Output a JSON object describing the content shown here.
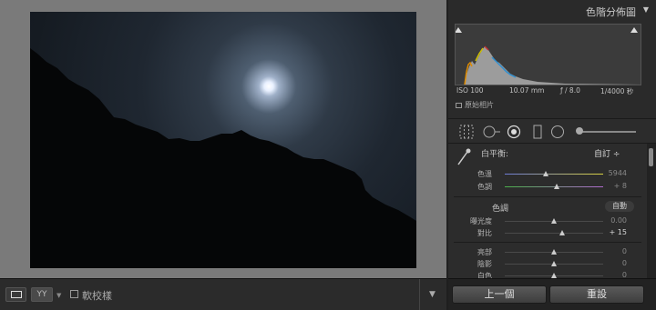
{
  "histogram": {
    "title": "色階分佈圖",
    "iso": "ISO 100",
    "focal": "10.07 mm",
    "aperture": "ƒ / 8.0",
    "shutter": "1/4000 秒",
    "original_label": "原始相片"
  },
  "basic": {
    "wb_label": "白平衡:",
    "wb_value": "自訂 ÷",
    "rows_wb": [
      {
        "label": "色溫",
        "value": "5944",
        "level": 0.42
      },
      {
        "label": "色調",
        "value": "+ 8",
        "level": 0.53
      }
    ],
    "tone_label": "色調",
    "auto_label": "自動",
    "rows_tone": [
      {
        "label": "曝光度",
        "value": "0.00",
        "level": 0.5
      },
      {
        "label": "對比",
        "value": "+ 15",
        "level": 0.58
      }
    ],
    "rows_detail": [
      {
        "label": "亮部",
        "value": "0",
        "level": 0.5
      },
      {
        "label": "陰影",
        "value": "0",
        "level": 0.5
      },
      {
        "label": "白色",
        "value": "0",
        "level": 0.5
      }
    ]
  },
  "bottom": {
    "prev_label": "上一個",
    "reset_label": "重設"
  },
  "toolbar": {
    "yy_label": "YY",
    "proof_label": "軟校樣"
  },
  "colors": {
    "temp_track": "#6c7bd6",
    "tint_track": "#b06ad0"
  }
}
